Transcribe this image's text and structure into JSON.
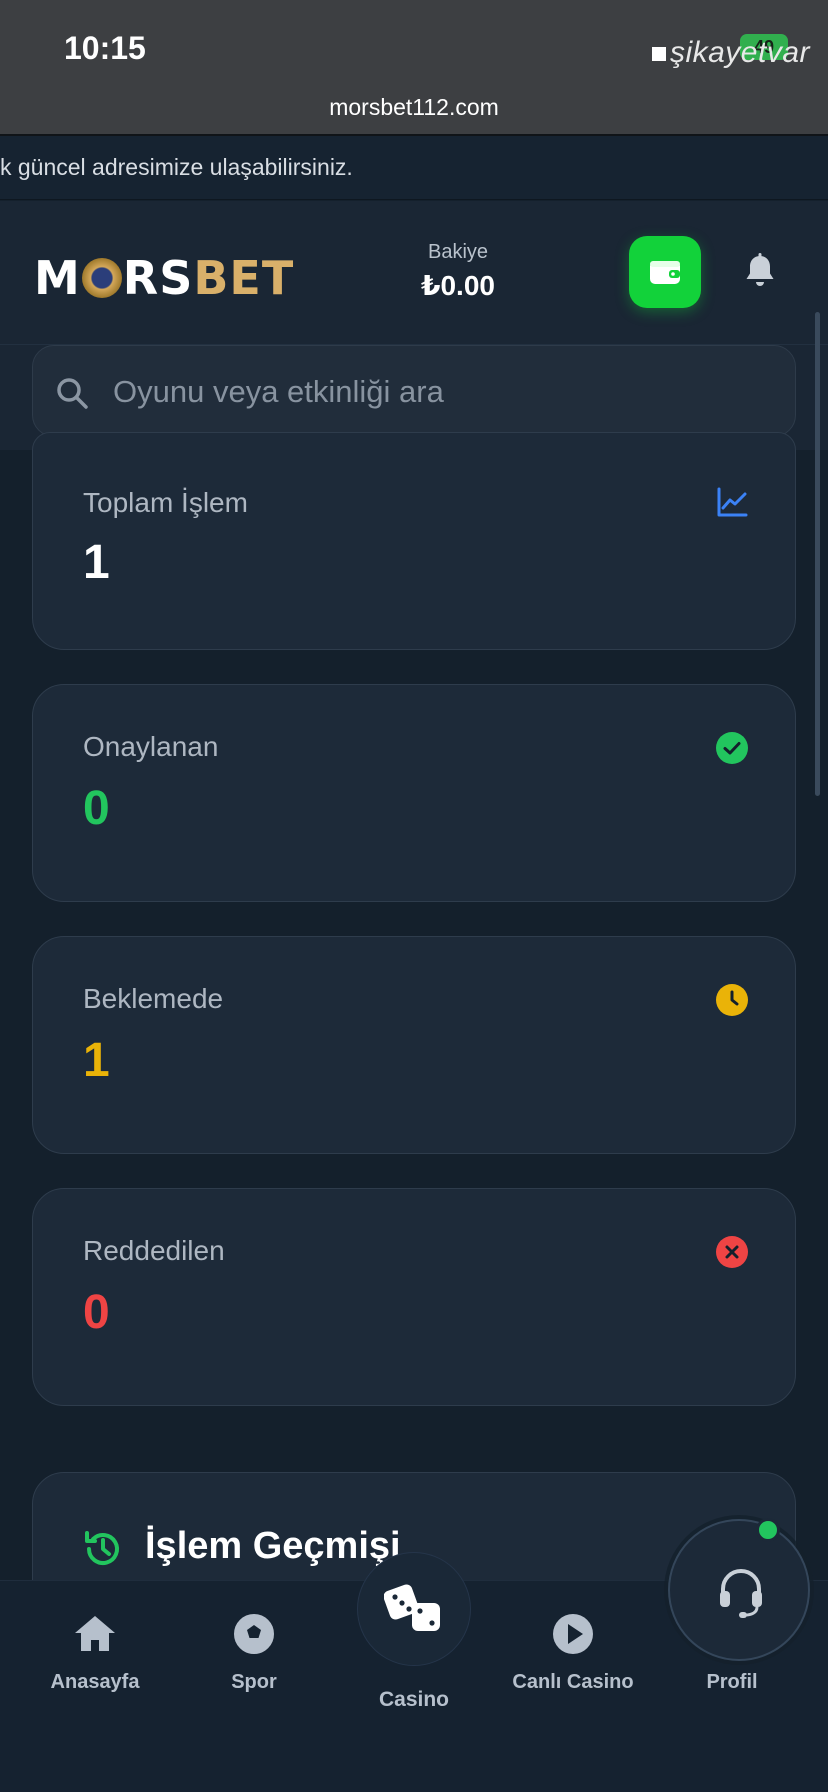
{
  "status_bar": {
    "time": "10:15",
    "watermark": "şikayetvar",
    "battery": "49"
  },
  "browser": {
    "url": "morsbet112.com"
  },
  "ticker": {
    "text": "k güncel adresimize ulaşabilirsiniz."
  },
  "header": {
    "logo": {
      "part1": "M",
      "part2": "RS",
      "part3": "BET"
    },
    "balance_label": "Bakiye",
    "balance_value": "₺0.00"
  },
  "search": {
    "placeholder": "Oyunu veya etkinliği ara"
  },
  "stats": [
    {
      "label": "Toplam İşlem",
      "value": "1",
      "color": "#ffffff",
      "icon": "chart-line-icon",
      "icon_color": "#3b82f6"
    },
    {
      "label": "Onaylanan",
      "value": "0",
      "color": "#22c55e",
      "icon": "check-circle-icon",
      "icon_color": "#22c55e"
    },
    {
      "label": "Beklemede",
      "value": "1",
      "color": "#eab308",
      "icon": "clock-icon",
      "icon_color": "#eab308"
    },
    {
      "label": "Reddedilen",
      "value": "0",
      "color": "#ef4444",
      "icon": "x-circle-icon",
      "icon_color": "#ef4444"
    }
  ],
  "history": {
    "title": "İşlem Geçmişi",
    "icon": "history-icon",
    "icon_color": "#22c55e"
  },
  "bottom_nav": [
    {
      "label": "Anasayfa",
      "icon": "home-icon"
    },
    {
      "label": "Spor",
      "icon": "soccer-ball-icon"
    },
    {
      "label": "Casino",
      "icon": "dice-icon"
    },
    {
      "label": "Canlı Casino",
      "icon": "play-circle-icon"
    },
    {
      "label": "Profil",
      "icon": "user-icon"
    }
  ],
  "support": {
    "icon": "headset-icon"
  },
  "colors": {
    "accent_green": "#12d23a",
    "bg": "#14202c",
    "card": "#1d2a39"
  }
}
